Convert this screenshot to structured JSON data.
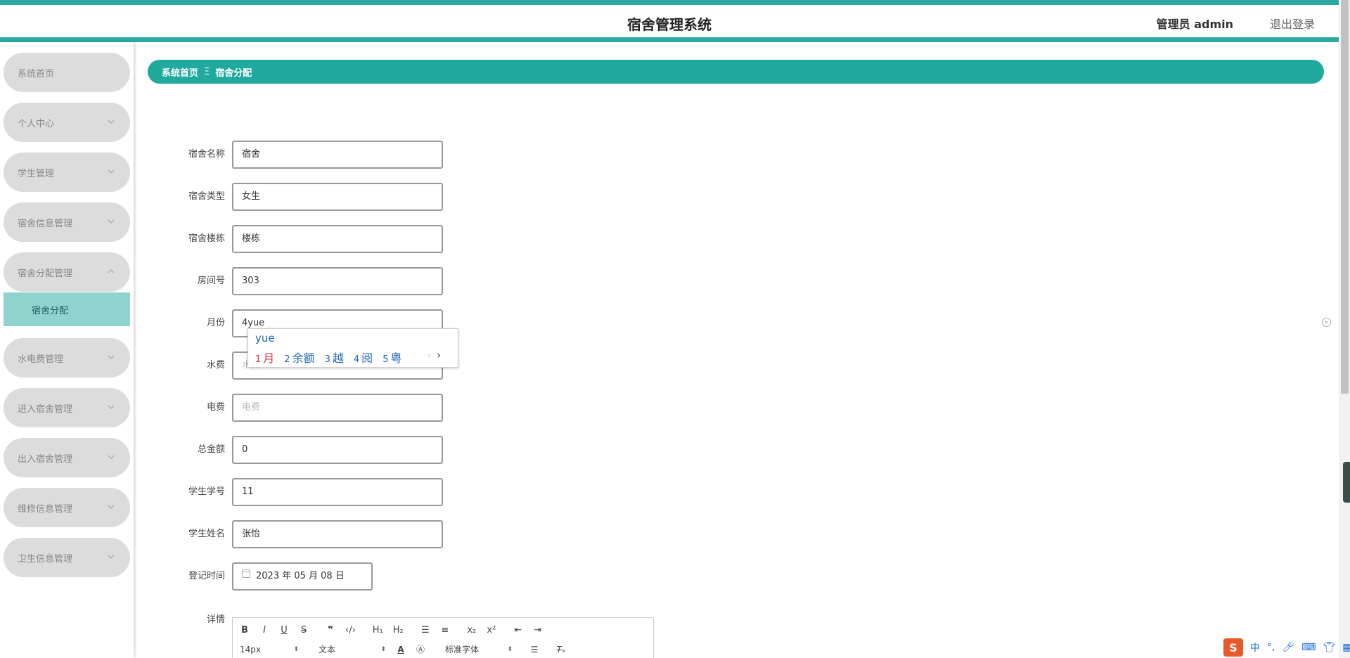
{
  "header": {
    "title": "宿舍管理系统",
    "user": "管理员 admin",
    "logout": "退出登录"
  },
  "sidebar": {
    "items": [
      {
        "label": "系统首页"
      },
      {
        "label": "个人中心"
      },
      {
        "label": "学生管理"
      },
      {
        "label": "宿舍信息管理"
      },
      {
        "label": "宿舍分配管理"
      },
      {
        "label": "水电费管理"
      },
      {
        "label": "进入宿舍管理"
      },
      {
        "label": "出入宿舍管理"
      },
      {
        "label": "维修信息管理"
      },
      {
        "label": "卫生信息管理"
      }
    ],
    "active_sub": "宿舍分配"
  },
  "breadcrumb": {
    "home": "系统首页",
    "separator": "Ξ",
    "current": "宿舍分配"
  },
  "form": {
    "fields": [
      {
        "label": "宿舍名称",
        "value": "宿舍"
      },
      {
        "label": "宿舍类型",
        "value": "女生"
      },
      {
        "label": "宿舍楼栋",
        "value": "楼栋"
      },
      {
        "label": "房间号",
        "value": "303"
      },
      {
        "label": "月份",
        "value": "4yue"
      },
      {
        "label": "水费",
        "placeholder": "水费"
      },
      {
        "label": "电费",
        "placeholder": "电费"
      },
      {
        "label": "总金额",
        "value": "0"
      },
      {
        "label": "学生学号",
        "value": "11"
      },
      {
        "label": "学生姓名",
        "value": "张怡"
      },
      {
        "label": "登记时间",
        "value": "2023 年 05 月 08 日"
      }
    ],
    "details_label": "详情"
  },
  "ime": {
    "composition": "yue",
    "candidates": [
      {
        "n": "1",
        "text": "月"
      },
      {
        "n": "2",
        "text": "余额"
      },
      {
        "n": "3",
        "text": "越"
      },
      {
        "n": "4",
        "text": "阅"
      },
      {
        "n": "5",
        "text": "粤"
      }
    ]
  },
  "editor": {
    "font_size": "14px",
    "paragraph": "文本",
    "font_family": "标准字体"
  },
  "tray": {
    "logo": "S",
    "lang": "中"
  }
}
